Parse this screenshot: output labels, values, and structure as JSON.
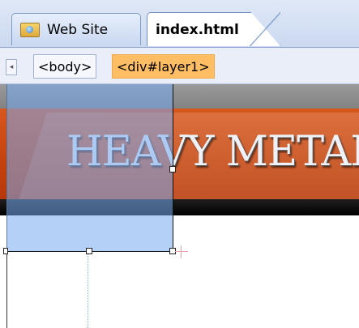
{
  "document_tabs": [
    {
      "label": "Web Site",
      "icon": "website-folder-icon",
      "active": false
    },
    {
      "label": "index.html",
      "active": true
    }
  ],
  "tag_selector": {
    "items": [
      {
        "label": "<body>",
        "selected": false
      },
      {
        "label": "<div#layer1>",
        "selected": true
      }
    ]
  },
  "canvas": {
    "banner_text": "HEAVY METAL",
    "selected_element": "div#layer1"
  },
  "colors": {
    "selected_tag": "#ffbe63",
    "layer_overlay": "#78aaf0",
    "banner_orange": "#c4420d"
  }
}
